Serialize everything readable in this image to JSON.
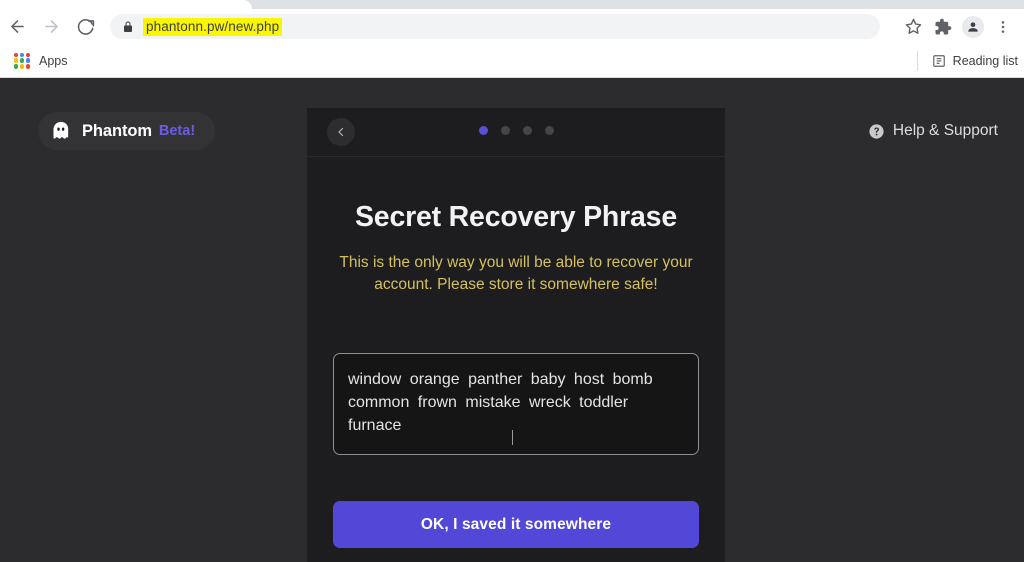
{
  "browser": {
    "nav": {
      "back_icon": "arrow-left-icon",
      "forward_icon": "arrow-right-icon",
      "reload_icon": "reload-icon"
    },
    "omnibox": {
      "lock_icon": "lock-icon",
      "url": "phantonn.pw/new.php",
      "highlight_color": "#faf500"
    },
    "toolbar_right": {
      "bookmark_icon": "star-icon",
      "extensions_icon": "puzzle-piece-icon",
      "profile_icon": "profile-avatar-icon",
      "menu_icon": "three-dot-menu-icon"
    },
    "bookmarks": {
      "apps_label": "Apps",
      "apps_icon": "apps-grid-icon",
      "reading_list_label": "Reading list",
      "reading_list_icon": "reading-list-icon"
    }
  },
  "page": {
    "brand": {
      "icon": "ghost-icon",
      "name": "Phantom",
      "beta": "Beta!",
      "beta_color": "#6b5ce7"
    },
    "help": {
      "icon": "question-circle-icon",
      "label": "Help & Support"
    }
  },
  "modal": {
    "back_icon": "chevron-left-icon",
    "steps": {
      "total": 4,
      "active_index": 0,
      "active_color": "#5b4fd6",
      "inactive_color": "#464649"
    },
    "title": "Secret Recovery Phrase",
    "warning": "This is the only way you will be able to recover your account. Please store it somewhere safe!",
    "warning_color": "#d4c05f",
    "seed_phrase": {
      "words": [
        "window",
        "orange",
        "panther",
        "baby",
        "host",
        "bomb",
        "common",
        "frown",
        "mistake",
        "wreck",
        "toddler",
        "furnace"
      ],
      "text": "window orange panther baby host bomb common frown mistake wreck toddler furnace",
      "word_count": 12
    },
    "confirm_button": {
      "label": "OK, I saved it somewhere",
      "color": "#5247d6"
    }
  }
}
